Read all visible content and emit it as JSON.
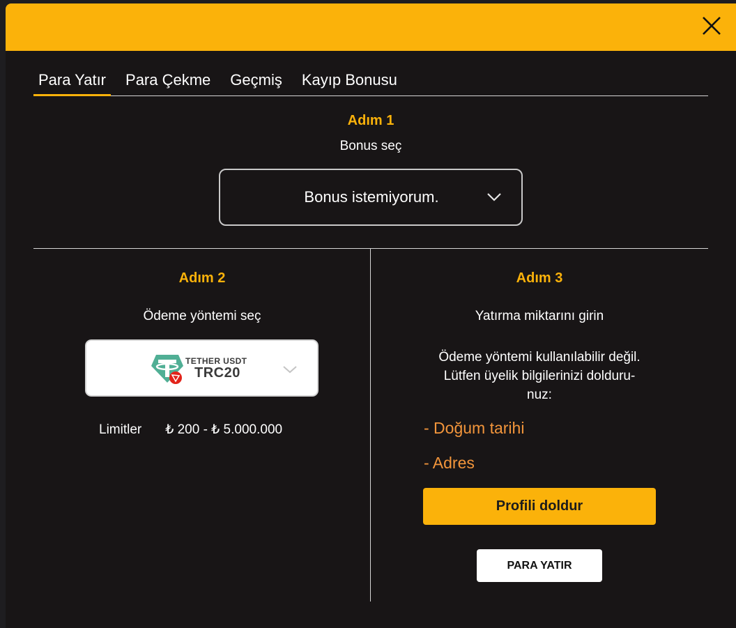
{
  "tabs": [
    {
      "label": "Para Yatır",
      "active": true
    },
    {
      "label": "Para Çekme",
      "active": false
    },
    {
      "label": "Geçmiş",
      "active": false
    },
    {
      "label": "Kayıp Bonusu",
      "active": false
    }
  ],
  "step1": {
    "title": "Adım 1",
    "subtitle": "Bonus seç",
    "bonus_selected": "Bonus istemiyorum."
  },
  "step2": {
    "title": "Adım 2",
    "subtitle": "Ödeme yöntemi seç",
    "payment_method": {
      "name": "TETHER USDT",
      "network": "TRC20",
      "icon": "tether-usdt-icon"
    },
    "limits_label": "Limitler",
    "limits_value": "₺ 200 - ₺ 5.000.000"
  },
  "step3": {
    "title": "Adım 3",
    "subtitle": "Yatırma miktarını girin",
    "notice_line1": "Ödeme yöntemi kullanılabilir değil.",
    "notice_line2": "Lütfen üyelik bilgilerinizi dolduru-",
    "notice_line3": "nuz:",
    "missing_fields": [
      "- Doğum tarihi",
      "- Adres"
    ],
    "fill_profile_label": "Profili doldur",
    "deposit_label": "PARA YATIR"
  },
  "colors": {
    "accent": "#fbb20a",
    "background": "#181516",
    "warning_text": "#f2953b",
    "tether_green": "#50af95"
  }
}
